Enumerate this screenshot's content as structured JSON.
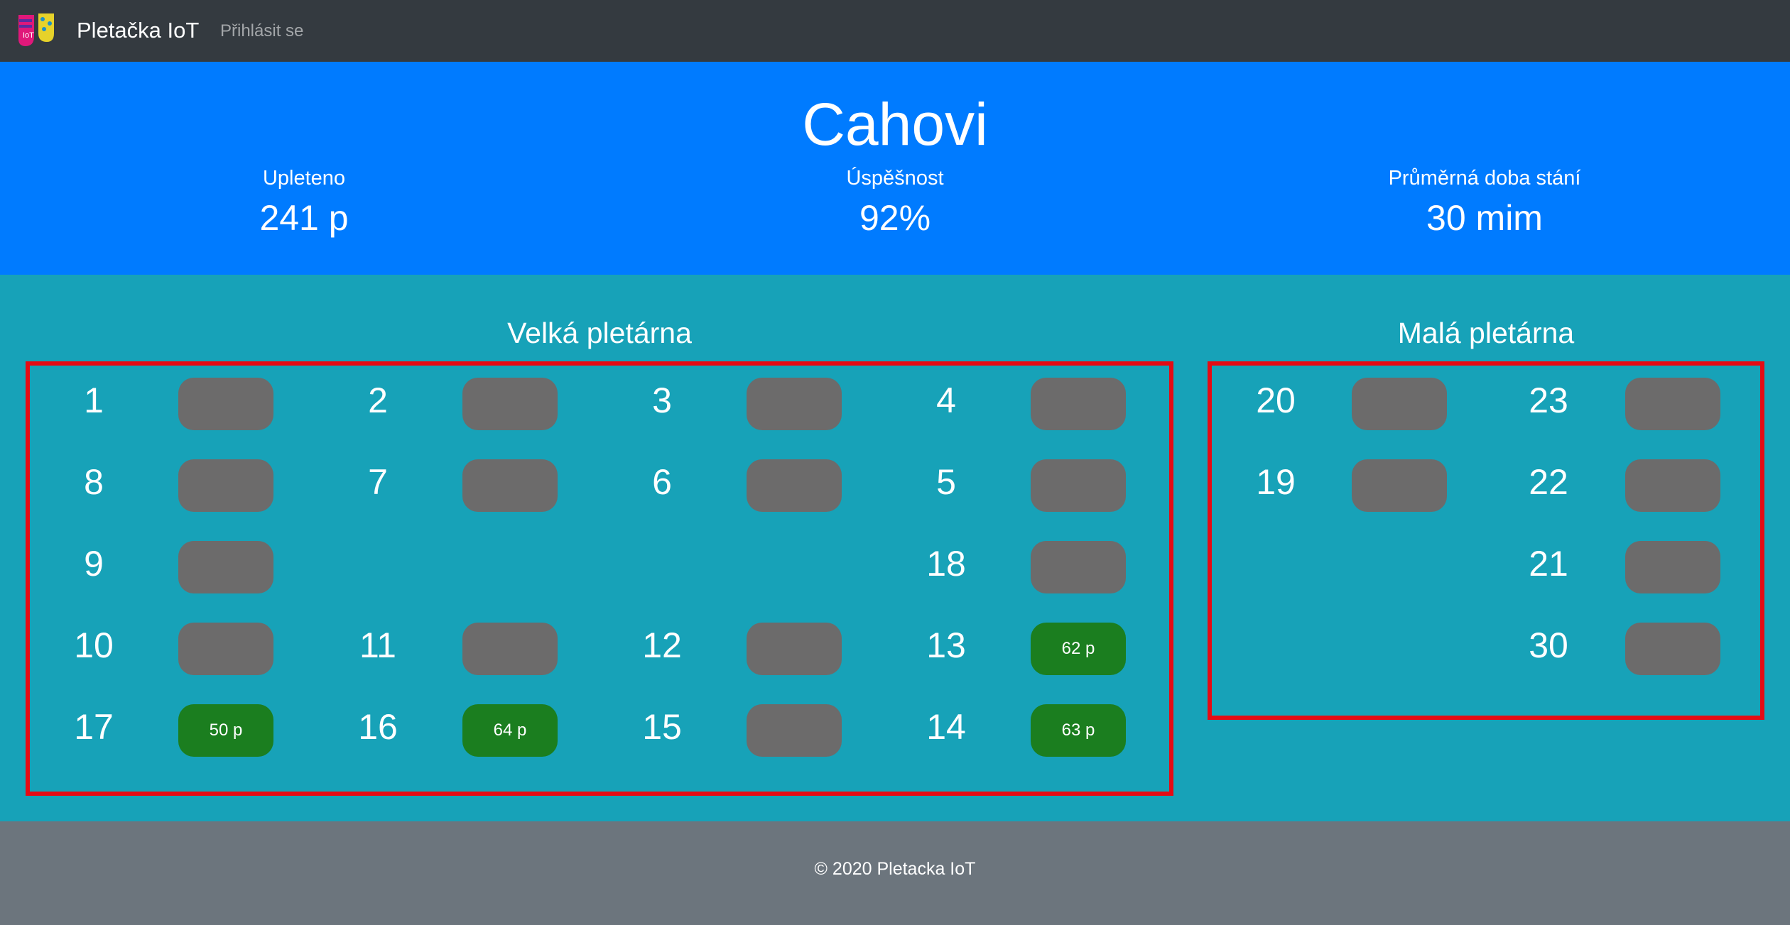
{
  "navbar": {
    "brand": "Pletačka IoT",
    "login_link": "Přihlásit se"
  },
  "hero": {
    "title": "Cahovi",
    "stats": [
      {
        "label": "Upleteno",
        "value": "241 p"
      },
      {
        "label": "Úspěšnost",
        "value": "92%"
      },
      {
        "label": "Průměrná doba stání",
        "value": "30 mim"
      }
    ]
  },
  "halls": {
    "big": {
      "title": "Velká pletárna",
      "machines": [
        {
          "num": "1",
          "label": "",
          "active": false
        },
        {
          "num": "2",
          "label": "",
          "active": false
        },
        {
          "num": "3",
          "label": "",
          "active": false
        },
        {
          "num": "4",
          "label": "",
          "active": false
        },
        {
          "num": "8",
          "label": "",
          "active": false
        },
        {
          "num": "7",
          "label": "",
          "active": false
        },
        {
          "num": "6",
          "label": "",
          "active": false
        },
        {
          "num": "5",
          "label": "",
          "active": false
        },
        {
          "num": "9",
          "label": "",
          "active": false
        },
        {
          "num": "18",
          "label": "",
          "active": false
        },
        {
          "num": "10",
          "label": "",
          "active": false
        },
        {
          "num": "11",
          "label": "",
          "active": false
        },
        {
          "num": "12",
          "label": "",
          "active": false
        },
        {
          "num": "13",
          "label": "62 p",
          "active": true
        },
        {
          "num": "17",
          "label": "50 p",
          "active": true
        },
        {
          "num": "16",
          "label": "64 p",
          "active": true
        },
        {
          "num": "15",
          "label": "",
          "active": false
        },
        {
          "num": "14",
          "label": "63 p",
          "active": true
        }
      ]
    },
    "small": {
      "title": "Malá pletárna",
      "machines": [
        {
          "num": "20",
          "label": "",
          "active": false
        },
        {
          "num": "23",
          "label": "",
          "active": false
        },
        {
          "num": "19",
          "label": "",
          "active": false
        },
        {
          "num": "22",
          "label": "",
          "active": false
        },
        {
          "num": "21",
          "label": "",
          "active": false
        },
        {
          "num": "30",
          "label": "",
          "active": false
        }
      ]
    }
  },
  "footer": {
    "text": "© 2020 Pletacka IoT"
  },
  "colors": {
    "navbar": "#343a40",
    "hero": "#007bff",
    "main": "#17a2b8",
    "machine_idle": "#6c6b6b",
    "machine_active": "#1b7e1f",
    "hall_border": "#e50b14",
    "footer": "#6c757d"
  }
}
